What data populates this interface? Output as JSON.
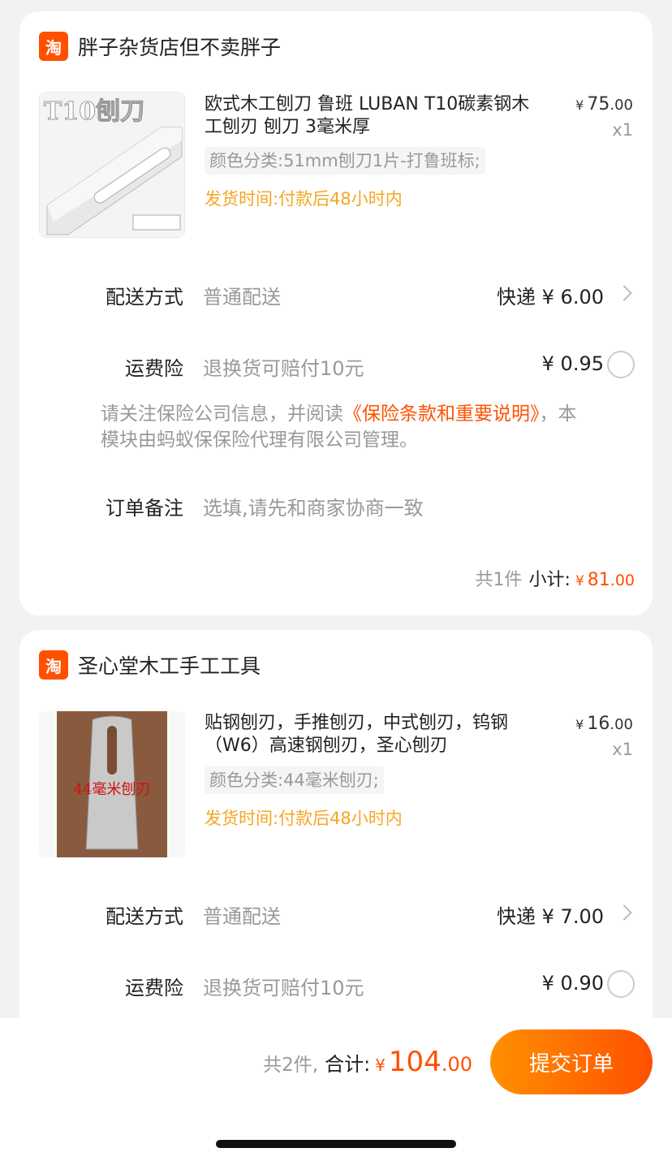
{
  "shops": [
    {
      "logo_char": "淘",
      "name": "胖子杂货店但不卖胖子",
      "product": {
        "image_text": "T10刨刀",
        "title": "欧式木工刨刀 鲁班 LUBAN T10碳素钢木工刨刃 刨刀 3毫米厚",
        "spec": "颜色分类:51mm刨刀1片-打鲁班标;",
        "ship_time": "发货时间:付款后48小时内",
        "price_currency": "¥",
        "price_int": "75",
        "price_dec": ".00",
        "qty": "x1"
      },
      "delivery": {
        "label": "配送方式",
        "value": "普通配送",
        "right": "快递 ¥ 6.00"
      },
      "insurance": {
        "label": "运费险",
        "value": "退换货可赔付10元",
        "right": "¥ 0.95"
      },
      "notice": {
        "prefix": "请关注保险公司信息，并阅读",
        "link": "《保险条款和重要说明》",
        "suffix": "，本模块由蚂蚁保保险代理有限公司管理。"
      },
      "remark": {
        "label": "订单备注",
        "placeholder": "选填,请先和商家协商一致"
      },
      "subtotal": {
        "count": "共1件",
        "label": "小计:",
        "currency": "¥",
        "int": "81",
        "dec": ".00"
      }
    },
    {
      "logo_char": "淘",
      "name": "圣心堂木工手工工具",
      "product": {
        "image_text": "44毫米刨刃",
        "title": "贴钢刨刃，手推刨刃，中式刨刃，钨钢（W6）高速钢刨刃，圣心刨刃",
        "spec": "颜色分类:44毫米刨刃;",
        "ship_time": "发货时间:付款后48小时内",
        "price_currency": "¥",
        "price_int": "16",
        "price_dec": ".00",
        "qty": "x1"
      },
      "delivery": {
        "label": "配送方式",
        "value": "普通配送",
        "right": "快递 ¥ 7.00"
      },
      "insurance": {
        "label": "运费险",
        "value": "退换货可赔付10元",
        "right": "¥ 0.90"
      }
    }
  ],
  "footer": {
    "count": "共2件,",
    "label": "合计:",
    "currency": "¥",
    "int": "104",
    "dec": ".00",
    "submit": "提交订单"
  },
  "colors": {
    "accent": "#ff5000",
    "ship_time": "#f5a623",
    "button_start": "#ff9000"
  }
}
